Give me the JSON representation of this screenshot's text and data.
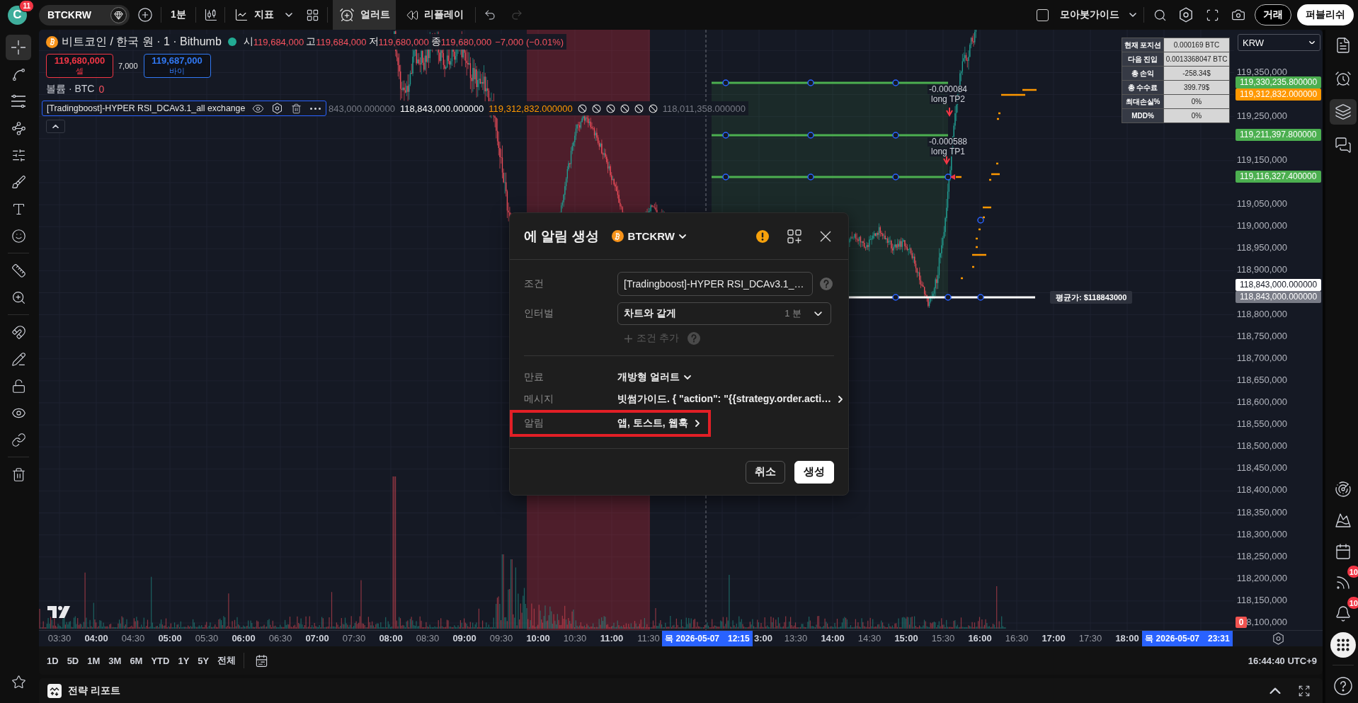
{
  "top_bar": {
    "avatar": {
      "letter": "C",
      "badge": "11"
    },
    "symbol": "BTCKRW",
    "interval": "1분",
    "indicators": "지표",
    "alert": {
      "label": "얼러트",
      "selected": true
    },
    "replay": {
      "label": "리플레이",
      "selected": false
    },
    "undo": {
      "disabled": false
    },
    "redo": {
      "disabled": true
    },
    "layout": {
      "name": "모아봇가이드",
      "checked": false
    },
    "trade_button": "거래",
    "publish_button": "퍼블리쉬"
  },
  "left_toolbar": {
    "tool_groups": [
      {
        "tools": [
          {
            "selected": true
          },
          {
            "selected": false
          },
          {
            "selected": false
          },
          {
            "selected": false
          },
          {
            "selected": false
          },
          {
            "selected": false
          },
          {
            "selected": false
          },
          {
            "selected": false
          }
        ]
      },
      {
        "tools": [
          {
            "selected": false
          },
          {
            "selected": false
          }
        ]
      },
      {
        "tools": [
          {
            "selected": false
          },
          {
            "selected": false
          },
          {
            "selected": false
          },
          {
            "selected": false
          },
          {
            "selected": false
          }
        ]
      },
      {
        "tools": [
          {
            "selected": false
          }
        ]
      }
    ]
  },
  "legend": {
    "title": "비트코인 / 한국 원 · 1 · Bithumb",
    "market_open": true,
    "ohlc": [
      {
        "label": "시",
        "value": "119,684,000"
      },
      {
        "label": "고",
        "value": "119,684,000"
      },
      {
        "label": "저",
        "value": "119,680,000"
      },
      {
        "label": "종",
        "value": "119,680,000"
      }
    ],
    "change": "−7,000 (−0.01%)",
    "sell": {
      "price": "119,680,000",
      "label": "셀"
    },
    "spread": "7,000",
    "buy": {
      "price": "119,687,000",
      "label": "바이"
    },
    "volume": {
      "label": "볼륨 · BTC",
      "value": "0"
    },
    "indicator": {
      "name": "[Tradingboost]-HYPER RSI_DCAv3.1_all exchange",
      "values": [
        {
          "kind": "number",
          "text": "843,000.000000",
          "color": "#787b86"
        },
        {
          "kind": "number",
          "text": "118,843,000.000000",
          "color": "#ffffff"
        },
        {
          "kind": "number",
          "text": "119,312,832.000000",
          "color": "#ff9800"
        },
        {
          "kind": "na"
        },
        {
          "kind": "na"
        },
        {
          "kind": "na"
        },
        {
          "kind": "na"
        },
        {
          "kind": "na"
        },
        {
          "kind": "na"
        },
        {
          "kind": "number",
          "text": "118,011,358.000000",
          "color": "#787b86"
        }
      ]
    }
  },
  "position_table": {
    "rows": [
      {
        "label": "현재 포지션",
        "value": "0.000169 BTC"
      },
      {
        "label": "다음 진입",
        "value": "0.0013368047 BTC"
      },
      {
        "label": "총 손익",
        "value": "-258.34$"
      },
      {
        "label": "총 수수료",
        "value": "399.79$"
      },
      {
        "label": "최대손실%",
        "value": "0%"
      },
      {
        "label": "MDD%",
        "value": "0%"
      }
    ]
  },
  "trade_levels": [
    {
      "value": "-0.000084",
      "label": "long TP2"
    },
    {
      "value": "-0.000588",
      "label": "long TP1"
    }
  ],
  "average_price_label": "평균가: $118843000",
  "currency_select": "KRW",
  "price_axis": {
    "ticks": [
      "119,350,000",
      "119,250,000",
      "119,150,000",
      "119,050,000",
      "119,000,000",
      "118,950,000",
      "118,900,000",
      "118,800,000",
      "118,750,000",
      "118,700,000",
      "118,650,000",
      "118,600,000",
      "118,550,000",
      "118,500,000",
      "118,450,000",
      "118,400,000",
      "118,350,000",
      "118,300,000",
      "118,250,000",
      "118,200,000",
      "118,150,000",
      "8,100,000"
    ],
    "labels": [
      {
        "text": "119,330,235.800000",
        "color": "#4caf50"
      },
      {
        "text": "119,312,832.000000",
        "color": "#ff9800"
      },
      {
        "text": "119,211,397.800000",
        "color": "#4caf50"
      },
      {
        "text": "119,116,327.400000",
        "color": "#4caf50"
      },
      {
        "text": "118,843,000.000000",
        "color": "#ffffff"
      },
      {
        "text": "118,843,000.000000",
        "color": "#787b86"
      }
    ],
    "volume_label": "0"
  },
  "time_axis": {
    "ticks_left": [
      "03:30",
      "04:00",
      "04:30",
      "05:00",
      "05:30",
      "06:00",
      "06:30",
      "07:00",
      "07:30",
      "08:00",
      "08:30",
      "09:00",
      "09:30",
      "10:00",
      "10:30",
      "11:00",
      "11:30"
    ],
    "crosshair_label": {
      "date": "목 2026-05-07",
      "time": "12:15"
    },
    "ticks_right": [
      "3:00",
      "13:30",
      "14:00",
      "14:30",
      "15:00",
      "15:30",
      "16:00",
      "16:30",
      "17:00",
      "17:30",
      "18:00"
    ],
    "end_label": {
      "date": "목 2026-05-07",
      "time": "23:31"
    }
  },
  "range_bar": {
    "ranges": [
      "1D",
      "5D",
      "1M",
      "3M",
      "6M",
      "YTD",
      "1Y",
      "5Y",
      "전체"
    ],
    "clock": "16:44:40 UTC+9"
  },
  "strategy_panel": {
    "title": "전략 리포트"
  },
  "right_sidebar": {
    "top": [
      {
        "selected": false
      },
      {
        "selected": false
      },
      {
        "selected": true
      },
      {
        "selected": false
      }
    ],
    "bottom": [
      {
        "selected": false
      },
      {
        "selected": false
      },
      {
        "selected": false
      },
      {
        "selected": false,
        "badge": "10"
      },
      {
        "selected": false,
        "badge": "10"
      },
      {
        "selected": false
      }
    ]
  },
  "alert_dialog": {
    "title": "에 알림 생성",
    "symbol": "BTCKRW",
    "fields": [
      {
        "kind": "select",
        "label": "조건",
        "value": "[Tradingboost]-HYPER RSI_DCAv3.1_…",
        "help": true
      },
      {
        "kind": "select",
        "label": "인터벌",
        "value": "차트와 같게",
        "suffix": "1 분"
      }
    ],
    "add_condition": {
      "label": "조건 추가",
      "disabled": true,
      "help": true
    },
    "settings": [
      {
        "kind": "dropdown",
        "label": "만료",
        "value": "개방형 얼러트",
        "highlighted": false
      },
      {
        "kind": "link",
        "label": "메시지",
        "value": "빗썸가이드. { \"action\": \"{{strategy.order.acti…",
        "highlighted": false
      },
      {
        "kind": "link",
        "label": "알림",
        "value": "앱, 토스트, 웹훅",
        "highlighted": true
      }
    ],
    "buttons": [
      {
        "label": "취소",
        "primary": false
      },
      {
        "label": "생성",
        "primary": true
      }
    ]
  }
}
